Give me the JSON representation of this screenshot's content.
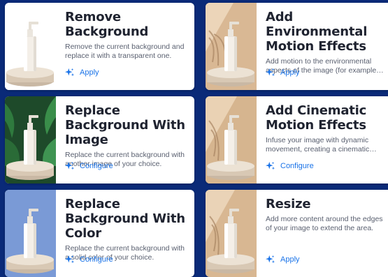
{
  "colors": {
    "background": "#0a2a78",
    "card": "#ffffff",
    "accent": "#1a73e8",
    "title": "#1f2330",
    "description": "#5a6070"
  },
  "cards": [
    {
      "title": "Remove Background",
      "description": "Remove the current background and replace it with a transparent one.",
      "action": "Apply",
      "action_icon": "sparkle-icon"
    },
    {
      "title": "Add Environmental Motion Effects",
      "description": "Add motion to the environmental aspects of the image (for example…",
      "action": "Apply",
      "action_icon": "sparkle-icon"
    },
    {
      "title": "Replace Background With Image",
      "description": "Replace the current background with another image of your choice.",
      "action": "Configure",
      "action_icon": "sparkle-icon"
    },
    {
      "title": "Add Cinematic Motion Effects",
      "description": "Infuse your image with dynamic movement, creating a cinematic…",
      "action": "Configure",
      "action_icon": "sparkle-icon"
    },
    {
      "title": "Replace Background With Color",
      "description": "Replace the current background with a solid color of your choice.",
      "action": "Configure",
      "action_icon": "sparkle-icon"
    },
    {
      "title": "Resize",
      "description": "Add more content around the edges of your image to extend the area.",
      "action": "Apply",
      "action_icon": "sparkle-icon"
    }
  ]
}
